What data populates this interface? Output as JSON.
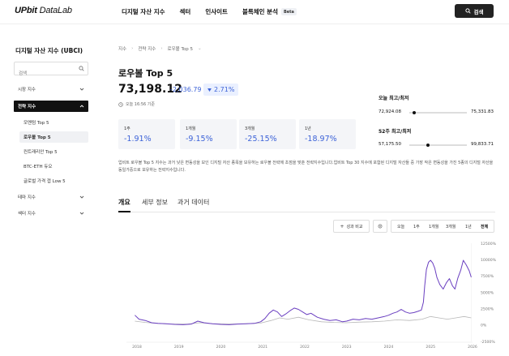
{
  "header": {
    "logo_bold": "UPbit",
    "logo_thin": " DataLab",
    "nav": [
      "디지털 자산 지수",
      "섹터",
      "인사이트",
      "블록체인 분석"
    ],
    "beta": "Beta",
    "search_label": "검색"
  },
  "sidebar": {
    "title": "디지털 자산 지수 (UBCI)",
    "search_placeholder": "검색",
    "items": [
      {
        "label": "시장 지수"
      },
      {
        "label": "전략 지수"
      },
      {
        "label": "테마 지수"
      },
      {
        "label": "섹터 지수"
      }
    ],
    "sub_items": [
      {
        "label": "모멘텀 Top 5"
      },
      {
        "label": "로우볼 Top 5"
      },
      {
        "label": "컨트래리안 Top 5"
      },
      {
        "label": "BTC-ETH 듀오"
      },
      {
        "label": "글로벌 가격 갭 Low 5"
      }
    ]
  },
  "breadcrumb": [
    "지수",
    "전략 지수",
    "로우볼 Top 5"
  ],
  "index": {
    "title": "로우볼 Top 5",
    "price": "73,198.12",
    "change": "-2,036.79",
    "change_pct": "2.71%",
    "updated": "오늘 16:56 기준"
  },
  "stats": [
    {
      "label": "1주",
      "value": "-1.91%"
    },
    {
      "label": "1개월",
      "value": "-9.15%"
    },
    {
      "label": "3개월",
      "value": "-25.15%"
    },
    {
      "label": "1년",
      "value": "-18.97%"
    }
  ],
  "ranges": {
    "today_title": "오늘 최고/최저",
    "today_low": "72,924.08",
    "today_high": "75,331.83",
    "today_position": 0.09,
    "week52_title": "52주 최고/최저",
    "week52_low": "57,175.50",
    "week52_high": "99,833.71",
    "week52_position": 0.33
  },
  "description": "업비트 로우볼 Top 5 지수는 과거 낮은 변동성을 보인 디지털 자산 종목을 보유하는 로우볼 전략에 초점을 맞춘 전략지수입니다.업비트 Top 30 지수에 포함된 디지털 자산들 중 가장 작은 변동성을 가진 5종의 디지털 자산을 동일가중으로 보유하는 전략지수입니다.",
  "tabs": [
    "개요",
    "세부 정보",
    "과거 데이터"
  ],
  "controls": {
    "compare_label": "성과 비교",
    "periods": [
      "오늘",
      "1주",
      "1개월",
      "3개월",
      "1년",
      "전체"
    ],
    "active_period": "전체"
  },
  "colors": {
    "accent_blue": "#3d63d8",
    "line_purple": "#6a3fc0",
    "line_gray": "#b8b8b8"
  },
  "chart_data": {
    "type": "line",
    "x_ticks": [
      "2018",
      "2019",
      "2020",
      "2021",
      "2022",
      "2023",
      "2024",
      "2025",
      "2026"
    ],
    "y_ticks": [
      "12500%",
      "10000%",
      "7500%",
      "5000%",
      "2500%",
      "0%",
      "-2500%"
    ],
    "ylim": [
      -2500,
      12500
    ],
    "series": [
      {
        "color": "#6a3fc0",
        "x": [
          2017.95,
          2018.05,
          2018.2,
          2018.35,
          2018.5,
          2018.7,
          2018.9,
          2019.1,
          2019.3,
          2019.45,
          2019.6,
          2019.8,
          2020.0,
          2020.2,
          2020.4,
          2020.6,
          2020.8,
          2020.95,
          2021.05,
          2021.15,
          2021.25,
          2021.35,
          2021.45,
          2021.55,
          2021.65,
          2021.75,
          2021.85,
          2021.95,
          2022.05,
          2022.15,
          2022.3,
          2022.45,
          2022.6,
          2022.75,
          2022.9,
          2023.0,
          2023.15,
          2023.3,
          2023.45,
          2023.6,
          2023.75,
          2023.9,
          2024.0,
          2024.1,
          2024.2,
          2024.3,
          2024.4,
          2024.5,
          2024.6,
          2024.7,
          2024.78,
          2024.83,
          2024.86,
          2024.9,
          2024.95,
          2025.0,
          2025.05,
          2025.1,
          2025.15,
          2025.22,
          2025.3,
          2025.38,
          2025.45,
          2025.52,
          2025.58,
          2025.65,
          2025.72,
          2025.78,
          2025.85,
          2025.92,
          2025.97
        ],
        "y": [
          1500,
          900,
          700,
          350,
          250,
          200,
          100,
          50,
          150,
          600,
          350,
          200,
          100,
          50,
          150,
          200,
          250,
          500,
          1000,
          1800,
          2300,
          2000,
          1300,
          1700,
          2200,
          2600,
          2400,
          2000,
          1600,
          1800,
          1200,
          900,
          700,
          800,
          500,
          600,
          900,
          800,
          1000,
          900,
          1100,
          1300,
          1500,
          1800,
          2000,
          2400,
          2000,
          1800,
          1900,
          2100,
          2300,
          3500,
          6000,
          8500,
          9600,
          9900,
          9500,
          8700,
          7300,
          6200,
          5500,
          6500,
          7100,
          6000,
          5500,
          7200,
          8400,
          9900,
          9200,
          8300,
          7300
        ]
      },
      {
        "color": "#b8b8b8",
        "x": [
          2017.95,
          2018.2,
          2018.5,
          2018.8,
          2019.2,
          2019.5,
          2019.8,
          2020.2,
          2020.6,
          2020.95,
          2021.2,
          2021.4,
          2021.6,
          2021.85,
          2022.1,
          2022.4,
          2022.7,
          2023.0,
          2023.3,
          2023.6,
          2023.9,
          2024.2,
          2024.5,
          2024.8,
          2025.0,
          2025.2,
          2025.4,
          2025.6,
          2025.8,
          2025.97
        ],
        "y": [
          600,
          400,
          250,
          150,
          150,
          350,
          200,
          150,
          200,
          300,
          700,
          1100,
          900,
          1200,
          800,
          500,
          400,
          350,
          450,
          500,
          600,
          800,
          700,
          900,
          1300,
          1100,
          900,
          1100,
          1300,
          1100
        ]
      }
    ]
  }
}
